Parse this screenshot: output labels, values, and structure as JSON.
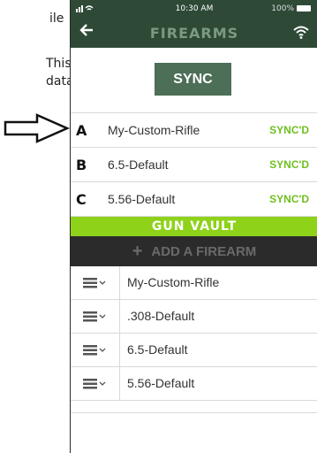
{
  "annotation": {
    "lines": [
      "ile",
      "This",
      "data"
    ]
  },
  "status_bar": {
    "time": "10:30 AM",
    "battery": "100%"
  },
  "header": {
    "back_icon": "arrow-left-icon",
    "title": "FIREARMS",
    "right_icon": "wifi-icon"
  },
  "sync": {
    "label": "SYNC"
  },
  "slots": [
    {
      "letter": "A",
      "name": "My-Custom-Rifle",
      "status": "SYNC'D"
    },
    {
      "letter": "B",
      "name": "6.5-Default",
      "status": "SYNC'D"
    },
    {
      "letter": "C",
      "name": "5.56-Default",
      "status": "SYNC'D"
    }
  ],
  "vault": {
    "header": "GUN VAULT",
    "add_label": "ADD A FIREARM",
    "items": [
      {
        "name": "My-Custom-Rifle"
      },
      {
        "name": ".308-Default"
      },
      {
        "name": "6.5-Default"
      },
      {
        "name": "5.56-Default"
      }
    ]
  },
  "colors": {
    "header_bg": "#2e4a37",
    "sync_button": "#4d6e57",
    "synced_green": "#6fbf1f",
    "vault_green": "#8ed21a",
    "add_bar_bg": "#2b2b2b"
  }
}
